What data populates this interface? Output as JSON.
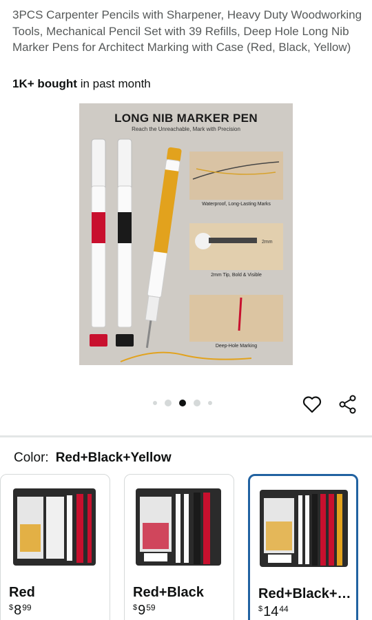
{
  "product": {
    "title": "3PCS Carpenter Pencils with Sharpener, Heavy Duty Woodworking Tools, Mechanical Pencil Set with 39 Refills, Deep Hole Long Nib Marker Pens for Architect Marking with Case (Red, Black, Yellow)",
    "bought_bold": "1K+ bought",
    "bought_rest": " in past month"
  },
  "hero_image": {
    "heading": "LONG NIB MARKER PEN",
    "subheading": "Reach the Unreachable, Mark with Precision",
    "pen_label": "LONG NIB MARKER",
    "captions": [
      "Waterproof, Long-Lasting Marks",
      "2mm Tip, Bold & Visible",
      "Deep-Hole Marking"
    ],
    "tip_label": "2mm"
  },
  "carousel": {
    "count": 5,
    "active_index": 2
  },
  "color_selector": {
    "label": "Color:",
    "selected": "Red+Black+Yellow"
  },
  "variants": [
    {
      "name": "Red",
      "currency": "$",
      "dollars": "8",
      "cents": "99",
      "selected": false
    },
    {
      "name": "Red+Black",
      "currency": "$",
      "dollars": "9",
      "cents": "59",
      "selected": false
    },
    {
      "name": "Red+Black+Yellow",
      "currency": "$",
      "dollars": "14",
      "cents": "44",
      "selected": true
    }
  ],
  "icons": [
    "heart-icon",
    "share-icon"
  ],
  "colors": {
    "selected_border": "#2162a1",
    "hero_bg": "#cfcbc5",
    "accent_yellow": "#e2a21d",
    "accent_red": "#c8102e"
  }
}
